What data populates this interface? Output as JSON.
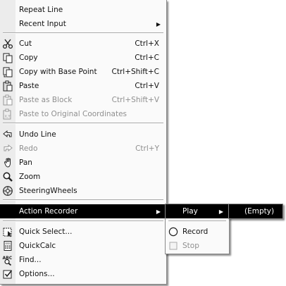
{
  "main_menu": {
    "repeat_line": "Repeat Line",
    "recent_input": "Recent Input",
    "cut": {
      "label": "Cut",
      "shortcut": "Ctrl+X"
    },
    "copy": {
      "label": "Copy",
      "shortcut": "Ctrl+C"
    },
    "copy_base": {
      "label": "Copy with Base Point",
      "shortcut": "Ctrl+Shift+C"
    },
    "paste": {
      "label": "Paste",
      "shortcut": "Ctrl+V"
    },
    "paste_block": {
      "label": "Paste as Block",
      "shortcut": "Ctrl+Shift+V"
    },
    "paste_original": {
      "label": "Paste to Original Coordinates"
    },
    "undo": {
      "label": "Undo Line"
    },
    "redo": {
      "label": "Redo",
      "shortcut": "Ctrl+Y"
    },
    "pan": {
      "label": "Pan"
    },
    "zoom": {
      "label": "Zoom"
    },
    "steering": {
      "label": "SteeringWheels"
    },
    "action_recorder": {
      "label": "Action Recorder"
    },
    "quick_select": {
      "label": "Quick Select..."
    },
    "quickcalc": {
      "label": "QuickCalc"
    },
    "find": {
      "label": "Find..."
    },
    "options": {
      "label": "Options..."
    }
  },
  "action_recorder_menu": {
    "play": "Play",
    "record": "Record",
    "stop": "Stop"
  },
  "play_menu": {
    "empty": "(Empty)"
  },
  "colors": {
    "highlight": "#000000",
    "menu_bg": "#fafafa",
    "disabled_text": "#8f8f8f"
  }
}
